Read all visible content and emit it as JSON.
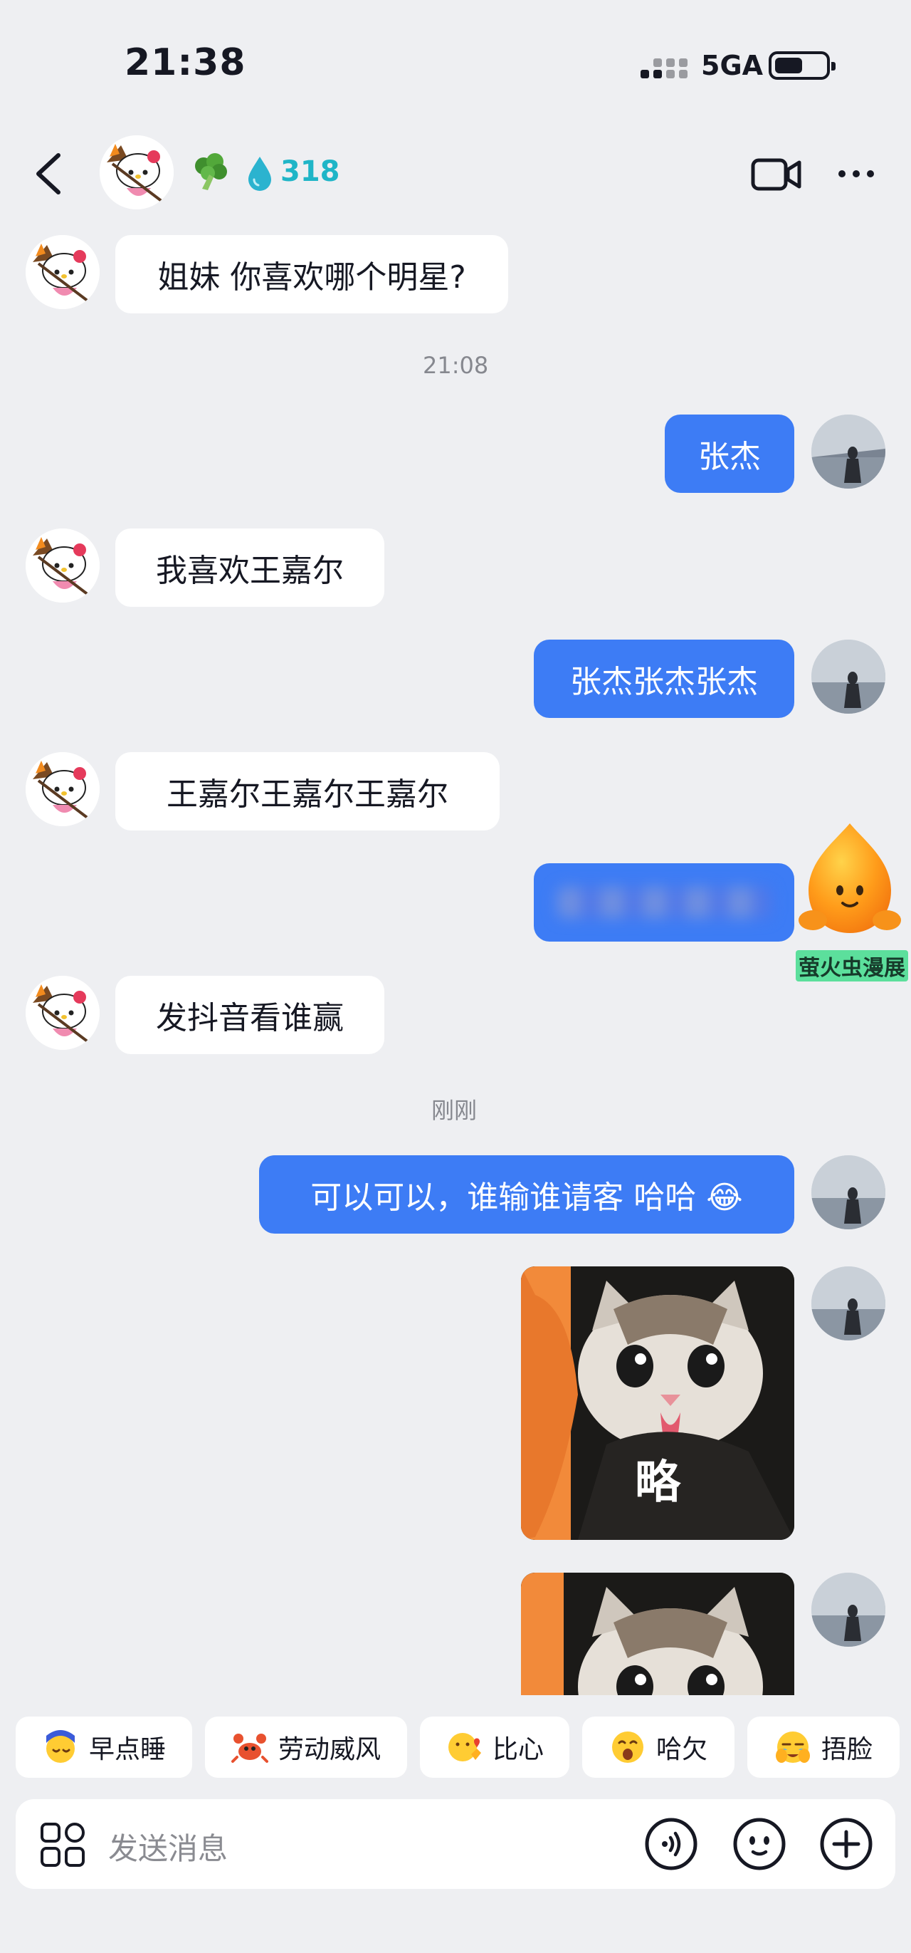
{
  "status_bar": {
    "time": "21:38",
    "network": "5GA"
  },
  "header": {
    "streak_count": "318",
    "icons": [
      "back-arrow-icon",
      "broccoli-icon",
      "water-drop-icon",
      "video-call-icon",
      "more-icon"
    ]
  },
  "messages": [
    {
      "from": "other",
      "text": "姐妹 你喜欢哪个明星?"
    },
    {
      "type": "timestamp",
      "text": "21:08"
    },
    {
      "from": "me",
      "text": "张杰"
    },
    {
      "from": "other",
      "text": "我喜欢王嘉尔"
    },
    {
      "from": "me",
      "text": "张杰张杰张杰"
    },
    {
      "from": "other",
      "text": "王嘉尔王嘉尔王嘉尔"
    },
    {
      "from": "me",
      "text": "",
      "blurred": true
    },
    {
      "from": "other",
      "text": "发抖音看谁赢"
    },
    {
      "type": "timestamp",
      "text": "刚刚"
    },
    {
      "from": "me",
      "text": "可以可以，谁输谁请客 哈哈 😂"
    },
    {
      "from": "me",
      "type": "image",
      "caption": "略"
    },
    {
      "from": "me",
      "type": "image",
      "caption": ""
    }
  ],
  "watermark": "萤火虫漫展",
  "quick_replies": [
    {
      "label": "早点睡",
      "icon": "sleepy-moon-icon"
    },
    {
      "label": "劳动威风",
      "icon": "crab-icon"
    },
    {
      "label": "比心",
      "icon": "heart-hand-icon"
    },
    {
      "label": "哈欠",
      "icon": "yawn-icon"
    },
    {
      "label": "捂脸",
      "icon": "facepalm-icon"
    }
  ],
  "input": {
    "placeholder": "发送消息"
  },
  "colors": {
    "background": "#eeeff2",
    "outgoing_bubble": "#3d7cf5",
    "incoming_bubble": "#ffffff",
    "streak": "#1fb5c7"
  }
}
